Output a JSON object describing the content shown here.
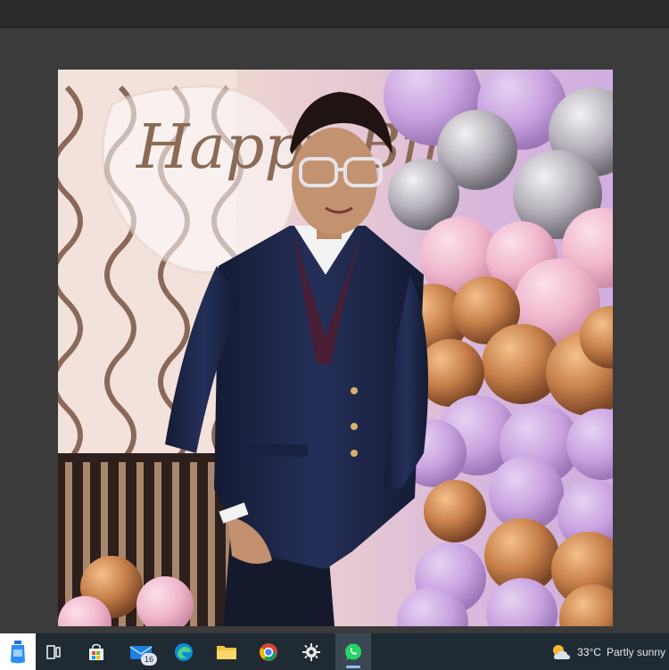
{
  "viewer": {
    "image_alt": "Boy in navy blazer posing in front of birthday balloon backdrop",
    "backdrop_sign_text": "Happy Birth"
  },
  "taskbar": {
    "items": [
      {
        "name": "start-app",
        "icon": "water-bottle-icon"
      },
      {
        "name": "task-view",
        "icon": "task-view-icon"
      },
      {
        "name": "microsoft-store",
        "icon": "store-icon"
      },
      {
        "name": "mail",
        "icon": "mail-icon",
        "badge": "16"
      },
      {
        "name": "edge",
        "icon": "edge-icon"
      },
      {
        "name": "file-explorer",
        "icon": "folder-icon"
      },
      {
        "name": "chrome",
        "icon": "chrome-icon"
      },
      {
        "name": "settings",
        "icon": "gear-icon"
      },
      {
        "name": "whatsapp",
        "icon": "whatsapp-icon",
        "active": true
      }
    ],
    "weather": {
      "temp": "33°C",
      "desc": "Partly sunny",
      "icon": "partly-sunny-icon"
    }
  },
  "colors": {
    "taskbar_bg": "#1f2a33",
    "viewer_bg": "#3b3b3b",
    "blazer": "#1e2747",
    "balloon_gold": "#c8804a",
    "balloon_lilac": "#c9a2e0",
    "balloon_pink": "#f0b6cc",
    "balloon_silver": "#b7b2bc"
  }
}
